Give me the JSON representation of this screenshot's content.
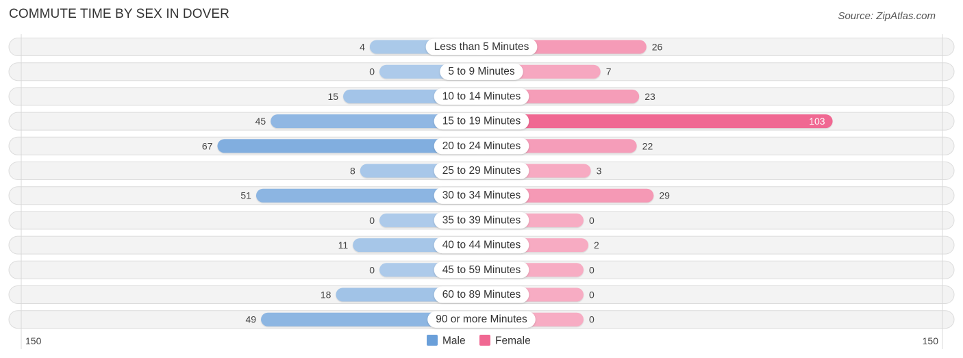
{
  "header": {
    "title": "COMMUTE TIME BY SEX IN DOVER",
    "source": "Source: ZipAtlas.com"
  },
  "chart_data": {
    "type": "bar",
    "orientation": "horizontal-diverging",
    "title": "COMMUTE TIME BY SEX IN DOVER",
    "categories": [
      "Less than 5 Minutes",
      "5 to 9 Minutes",
      "10 to 14 Minutes",
      "15 to 19 Minutes",
      "20 to 24 Minutes",
      "25 to 29 Minutes",
      "30 to 34 Minutes",
      "35 to 39 Minutes",
      "40 to 44 Minutes",
      "45 to 59 Minutes",
      "60 to 89 Minutes",
      "90 or more Minutes"
    ],
    "series": [
      {
        "name": "Male",
        "color": "#6a9fd9",
        "values": [
          4,
          0,
          15,
          45,
          67,
          8,
          51,
          0,
          11,
          0,
          18,
          49
        ]
      },
      {
        "name": "Female",
        "color": "#f06892",
        "values": [
          26,
          7,
          23,
          103,
          22,
          3,
          29,
          0,
          2,
          0,
          0,
          0
        ]
      }
    ],
    "axis": {
      "left_label": "150",
      "right_label": "150",
      "max": 150
    },
    "legend": {
      "position": "bottom-center",
      "items": [
        "Male",
        "Female"
      ]
    }
  }
}
